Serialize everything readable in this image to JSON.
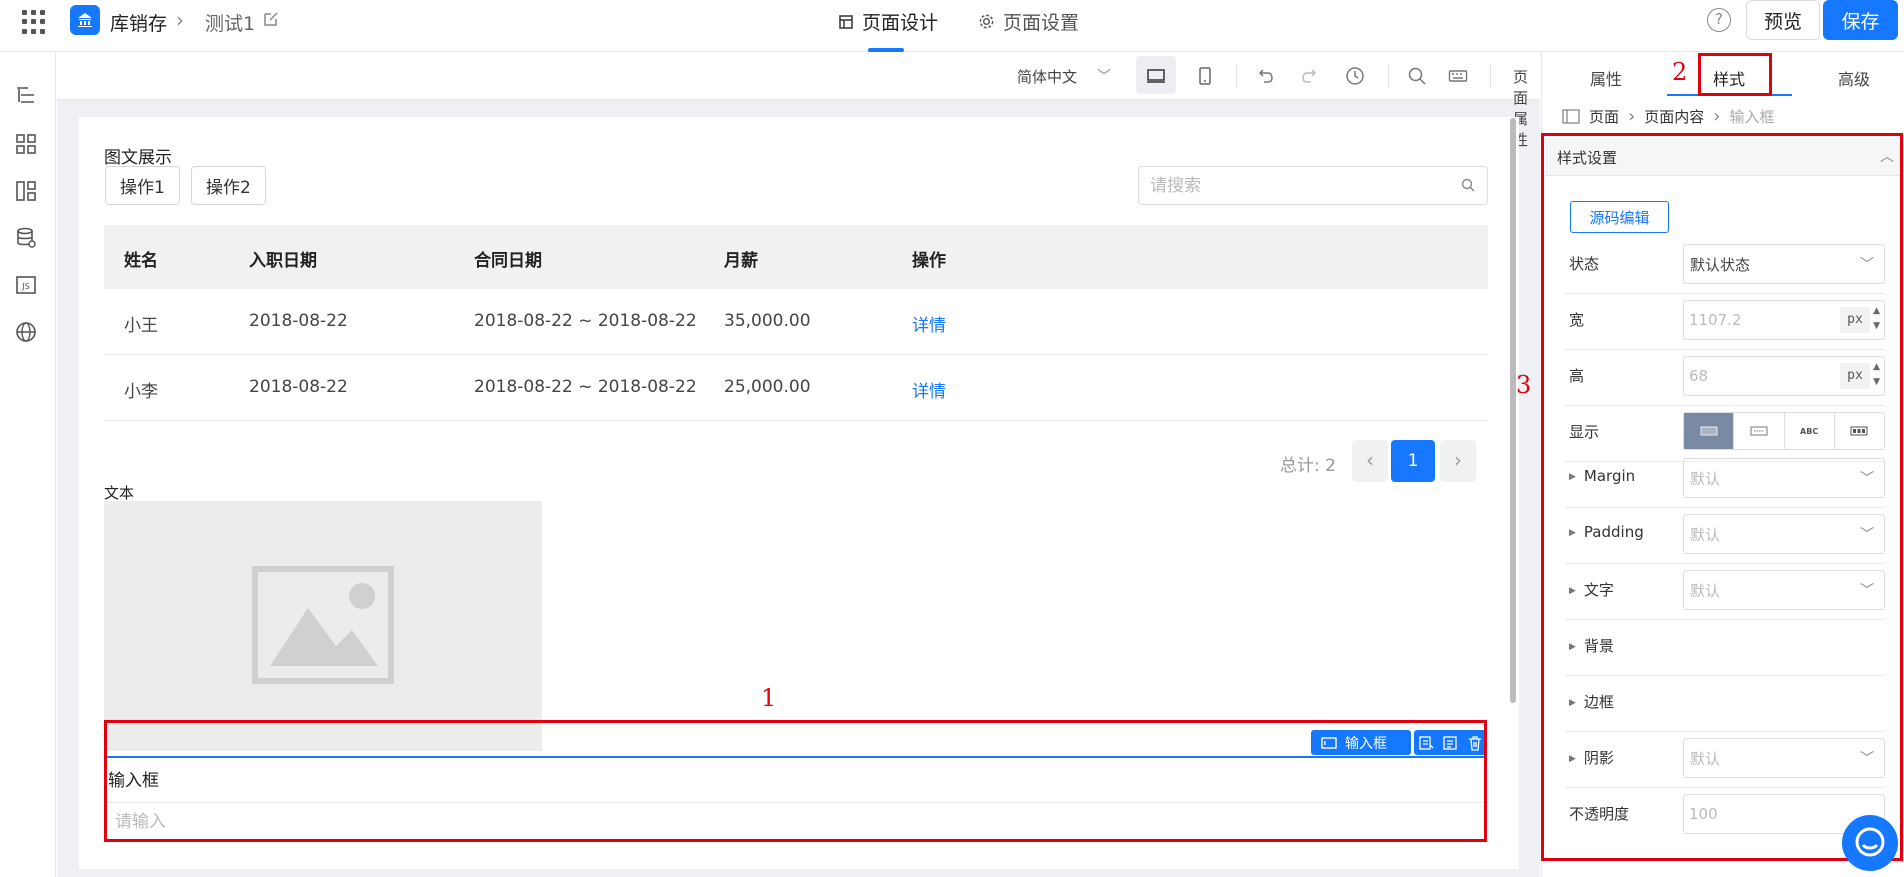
{
  "header": {
    "app_name": "库销存",
    "page_name": "测试1",
    "tabs": [
      {
        "label": "页面设计"
      },
      {
        "label": "页面设置"
      }
    ],
    "preview_label": "预览",
    "save_label": "保存"
  },
  "toolbar": {
    "language": "简体中文",
    "page_props_label": "页面属性"
  },
  "canvas": {
    "section_title": "图文展示",
    "buttons": [
      "操作1",
      "操作2"
    ],
    "search_placeholder": "请搜索",
    "table": {
      "columns": [
        "姓名",
        "入职日期",
        "合同日期",
        "月薪",
        "操作"
      ],
      "rows": [
        [
          "小王",
          "2018-08-22",
          "2018-08-22 ~ 2018-08-22",
          "35,000.00",
          "详情"
        ],
        [
          "小李",
          "2018-08-22",
          "2018-08-22 ~ 2018-08-22",
          "25,000.00",
          "详情"
        ]
      ]
    },
    "pagination": {
      "total_text": "总计: 2",
      "current_page": "1"
    },
    "text_component_label": "文本",
    "selected_component": {
      "badge_label": "输入框",
      "label": "输入框",
      "placeholder": "请输入"
    }
  },
  "annotations": [
    "1",
    "2",
    "3"
  ],
  "right_panel": {
    "tabs": [
      "属性",
      "样式",
      "高级"
    ],
    "active_tab": "样式",
    "breadcrumb": [
      "页面",
      "页面内容",
      "输入框"
    ],
    "section_title": "样式设置",
    "source_edit_label": "源码编辑",
    "props": {
      "state": {
        "label": "状态",
        "value": "默认状态"
      },
      "width": {
        "label": "宽",
        "placeholder": "1107.2",
        "unit": "px"
      },
      "height": {
        "label": "高",
        "placeholder": "68",
        "unit": "px"
      },
      "display": {
        "label": "显示",
        "options": [
          "ABC",
          "ABC"
        ]
      },
      "margin": {
        "label": "Margin",
        "value": "默认"
      },
      "padding": {
        "label": "Padding",
        "value": "默认"
      },
      "text": {
        "label": "文字",
        "value": "默认"
      },
      "background": {
        "label": "背景"
      },
      "border": {
        "label": "边框"
      },
      "shadow": {
        "label": "阴影",
        "value": "默认"
      },
      "opacity": {
        "label": "不透明度",
        "placeholder": "100"
      }
    }
  },
  "colors": {
    "accent": "#1677ff",
    "annotation": "#e0000f"
  }
}
